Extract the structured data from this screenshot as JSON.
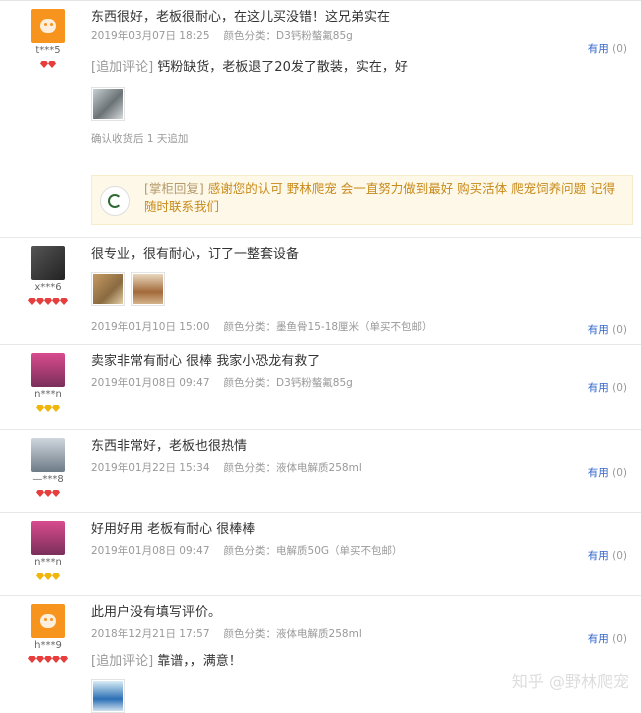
{
  "reviews": [
    {
      "user": {
        "name": "t***5",
        "avatar": "orange-mascot-icon",
        "level_gems": 2,
        "gem_color": "#e63d3d"
      },
      "text": "东西很好，老板很耐心，在这儿买没错！这兄弟实在",
      "date": "2019年03月07日 18:25",
      "category": "颜色分类：D3钙粉螯氟85g",
      "useful_label": "有用",
      "useful_count": "(0)",
      "append": {
        "label": "[追加评论]",
        "text": "钙粉缺货，老板退了20发了散装，实在，好",
        "confirm": "确认收货后 1 天追加"
      },
      "reply": {
        "label": "[掌柜回复]",
        "text": "感谢您的认可 野林爬宠 会一直努力做到最好 购买活体 爬宠饲养问题 记得随时联系我们"
      }
    },
    {
      "user": {
        "name": "x***6",
        "avatar": "user-photo-dark",
        "level_gems": 5,
        "gem_color": "#e63d3d"
      },
      "text": "很专业，很有耐心，订了一整套设备",
      "date": "2019年01月10日 15:00",
      "category": "颜色分类：墨鱼骨15-18厘米（单买不包邮）",
      "useful_label": "有用",
      "useful_count": "(0)"
    },
    {
      "user": {
        "name": "n***n",
        "avatar": "anime-girl-pink",
        "level_gems": 3,
        "gem_color": "#f1b60d"
      },
      "text": "卖家非常有耐心 很棒 我家小恐龙有救了",
      "date": "2019年01月08日 09:47",
      "category": "颜色分类：D3钙粉螯氟85g",
      "useful_label": "有用",
      "useful_count": "(0)"
    },
    {
      "user": {
        "name": "—***8",
        "avatar": "user-photo-man",
        "level_gems": 3,
        "gem_color": "#e63d3d"
      },
      "text": "东西非常好，老板也很热情",
      "date": "2019年01月22日 15:34",
      "category": "颜色分类：液体电解质258ml",
      "useful_label": "有用",
      "useful_count": "(0)"
    },
    {
      "user": {
        "name": "n***n",
        "avatar": "anime-girl-pink",
        "level_gems": 3,
        "gem_color": "#f1b60d"
      },
      "text": "好用好用 老板有耐心 很棒棒",
      "date": "2019年01月08日 09:47",
      "category": "颜色分类：电解质50G（单买不包邮）",
      "useful_label": "有用",
      "useful_count": "(0)"
    },
    {
      "user": {
        "name": "h***9",
        "avatar": "orange-mascot-icon",
        "level_gems": 5,
        "gem_color": "#e63d3d"
      },
      "text": "此用户没有填写评价。",
      "date": "2018年12月21日 17:57",
      "category": "颜色分类：液体电解质258ml",
      "useful_label": "有用",
      "useful_count": "(0)",
      "append": {
        "label": "[追加评论]",
        "text": "靠谱，，满意！"
      }
    }
  ],
  "watermark": "知乎 @野林爬宠"
}
